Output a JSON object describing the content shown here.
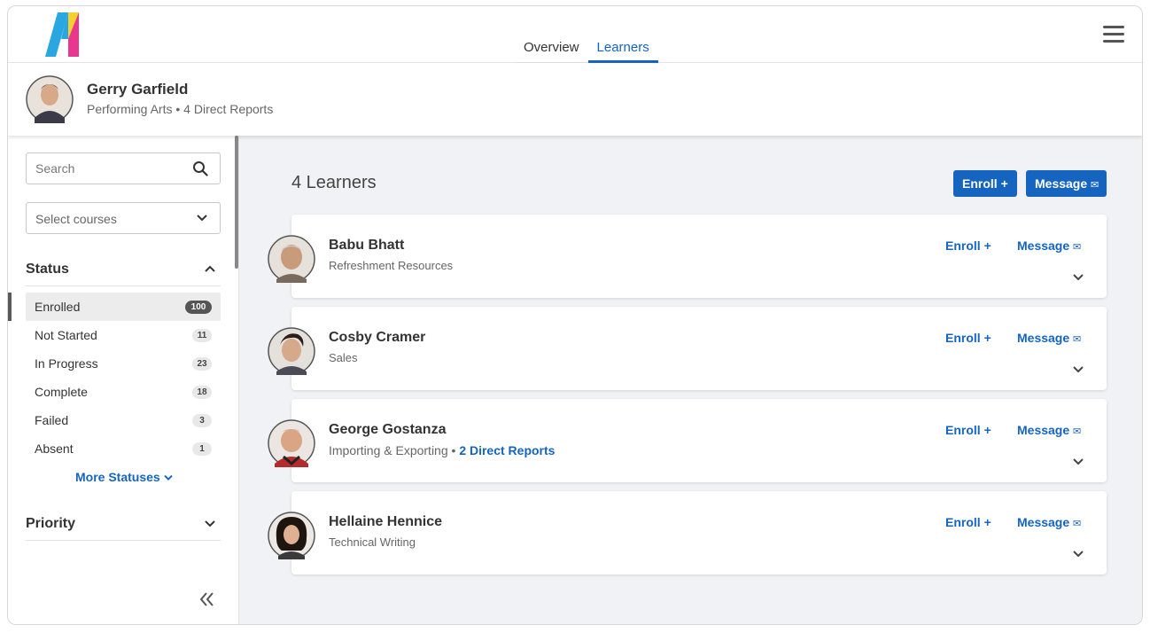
{
  "nav": {
    "tabs": [
      {
        "label": "Overview"
      },
      {
        "label": "Learners"
      }
    ]
  },
  "profile": {
    "name": "Gerry Garfield",
    "department": "Performing Arts",
    "reports": "4 Direct Reports",
    "separator": "•"
  },
  "sidebar": {
    "search_placeholder": "Search",
    "select_label": "Select courses",
    "status_title": "Status",
    "statuses": [
      {
        "label": "Enrolled",
        "count": "100"
      },
      {
        "label": "Not Started",
        "count": "11"
      },
      {
        "label": "In Progress",
        "count": "23"
      },
      {
        "label": "Complete",
        "count": "18"
      },
      {
        "label": "Failed",
        "count": "3"
      },
      {
        "label": "Absent",
        "count": "1"
      }
    ],
    "more_label": "More Statuses",
    "priority_title": "Priority"
  },
  "main": {
    "count_label": "4 Learners",
    "enroll_label": "Enroll",
    "message_label": "Message",
    "learners": [
      {
        "name": "Babu Bhatt",
        "dept": "Refreshment Resources",
        "reports": ""
      },
      {
        "name": "Cosby Cramer",
        "dept": "Sales",
        "reports": ""
      },
      {
        "name": "George Gostanza",
        "dept": "Importing & Exporting",
        "separator": "•",
        "reports": "2 Direct Reports"
      },
      {
        "name": "Hellaine Hennice",
        "dept": "Technical Writing",
        "reports": ""
      }
    ]
  },
  "colors": {
    "accent": "#1565c0",
    "background": "#f1f2f5"
  }
}
